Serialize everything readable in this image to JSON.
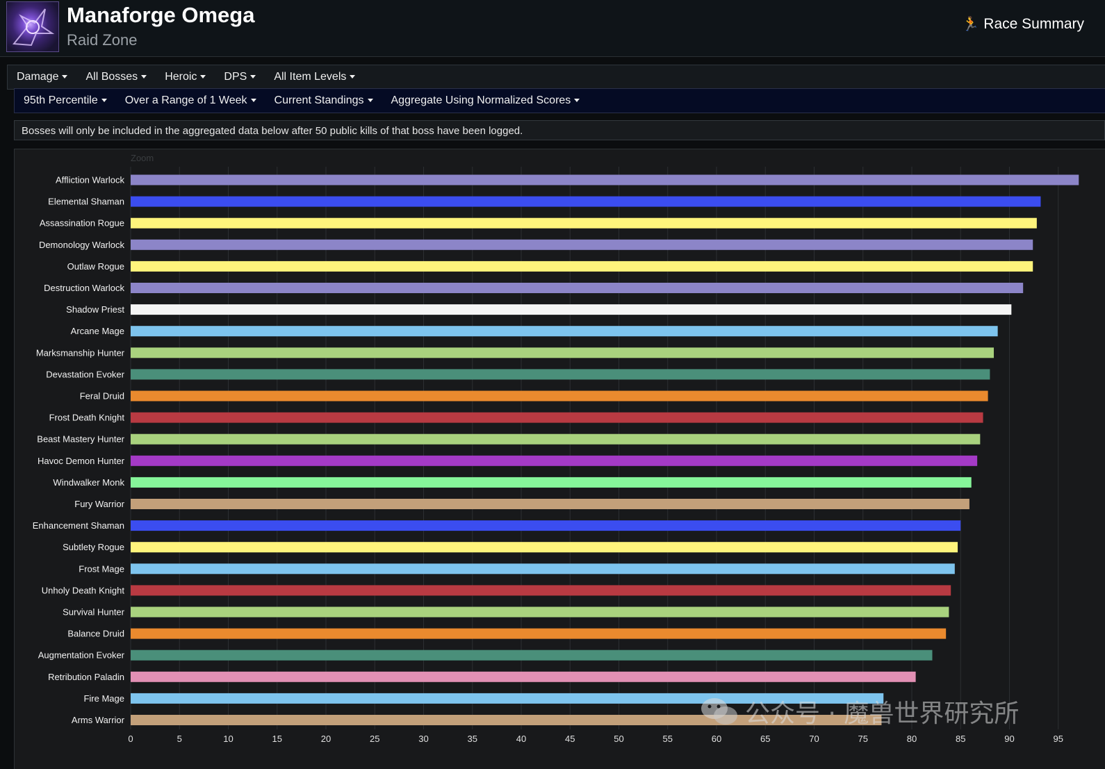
{
  "header": {
    "title": "Manaforge Omega",
    "subtitle": "Raid Zone",
    "race_summary_label": "Race Summary",
    "race_summary_icon": "running-person-icon"
  },
  "filters_row1": [
    "Damage",
    "All Bosses",
    "Heroic",
    "DPS",
    "All Item Levels"
  ],
  "filters_row2": [
    "95th Percentile",
    "Over a Range of 1 Week",
    "Current Standings",
    "Aggregate Using Normalized Scores"
  ],
  "notice": "Bosses will only be included in the aggregated data below after 50 public kills of that boss have been logged.",
  "zoom_label": "Zoom",
  "watermark": "公众号 · 魔兽世界研究所",
  "chart_data": {
    "type": "bar",
    "orientation": "horizontal",
    "title": "",
    "xlabel": "",
    "ylabel": "",
    "xlim": [
      0,
      97
    ],
    "x_ticks": [
      0,
      5,
      10,
      15,
      20,
      25,
      30,
      35,
      40,
      45,
      50,
      55,
      60,
      65,
      70,
      75,
      80,
      85,
      90,
      95
    ],
    "grid": true,
    "categories": [
      "Affliction Warlock",
      "Elemental Shaman",
      "Assassination Rogue",
      "Demonology Warlock",
      "Outlaw Rogue",
      "Destruction Warlock",
      "Shadow Priest",
      "Arcane Mage",
      "Marksmanship Hunter",
      "Devastation Evoker",
      "Feral Druid",
      "Frost Death Knight",
      "Beast Mastery Hunter",
      "Havoc Demon Hunter",
      "Windwalker Monk",
      "Fury Warrior",
      "Enhancement Shaman",
      "Subtlety Rogue",
      "Frost Mage",
      "Unholy Death Knight",
      "Survival Hunter",
      "Balance Druid",
      "Augmentation Evoker",
      "Retribution Paladin",
      "Fire Mage",
      "Arms Warrior"
    ],
    "values": [
      97.1,
      93.2,
      92.8,
      92.4,
      92.4,
      91.4,
      90.2,
      88.8,
      88.4,
      88.0,
      87.8,
      87.3,
      87.0,
      86.7,
      86.1,
      85.9,
      85.0,
      84.7,
      84.4,
      84.0,
      83.8,
      83.5,
      82.1,
      80.4,
      77.1,
      76.9
    ],
    "colors": [
      "#8c85c8",
      "#3b4df0",
      "#fff47c",
      "#8c85c8",
      "#fff47c",
      "#8c85c8",
      "#f5f5f5",
      "#7ec4ee",
      "#a9d27e",
      "#4a8f7a",
      "#ea8a2e",
      "#b83a42",
      "#a9d27e",
      "#a43ac6",
      "#86f59a",
      "#c3a07a",
      "#3b4df0",
      "#fff47c",
      "#7ec4ee",
      "#b83a42",
      "#a9d27e",
      "#ea8a2e",
      "#4a8f7a",
      "#e290b4",
      "#7ec4ee",
      "#c3a07a"
    ]
  }
}
